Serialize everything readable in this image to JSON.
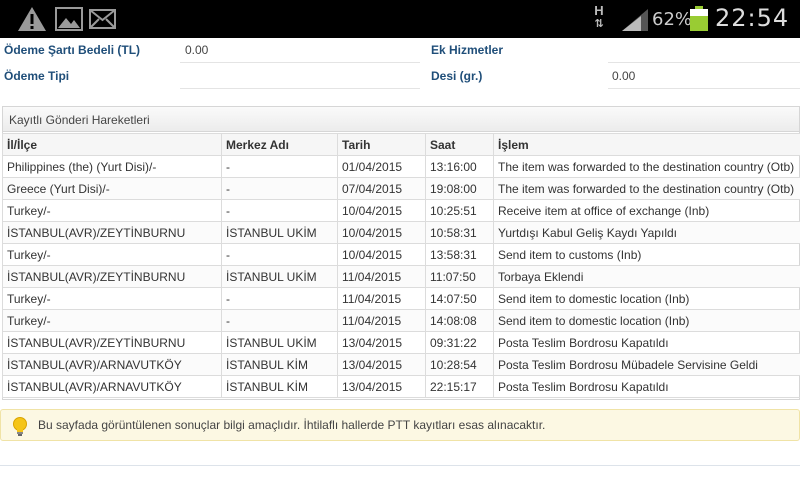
{
  "status_bar": {
    "battery_percent": "62%",
    "time": "22:54",
    "network_type": "H",
    "icons": [
      "warning-icon",
      "picture-icon",
      "mail-icon",
      "signal-icon",
      "battery-icon"
    ]
  },
  "info": {
    "row1": {
      "left_label": "Ödeme Şartı Bedeli (TL)",
      "left_value": "0.00",
      "right_label": "Ek Hizmetler",
      "right_value": ""
    },
    "row2": {
      "left_label": "Ödeme Tipi",
      "left_value": "",
      "right_label": "Desi (gr.)",
      "right_value": "0.00"
    }
  },
  "panel": {
    "title": "Kayıtlı Gönderi Hareketleri",
    "columns": [
      "İl/İlçe",
      "Merkez Adı",
      "Tarih",
      "Saat",
      "İşlem"
    ],
    "rows": [
      [
        "Philippines (the) (Yurt Disi)/-",
        "-",
        "01/04/2015",
        "13:16:00",
        "The item was forwarded to the destination country (Otb)"
      ],
      [
        "Greece (Yurt Disi)/-",
        "-",
        "07/04/2015",
        "19:08:00",
        "The item was forwarded to the destination country (Otb)"
      ],
      [
        "Turkey/-",
        "-",
        "10/04/2015",
        "10:25:51",
        "Receive item at office of exchange (Inb)"
      ],
      [
        "İSTANBUL(AVR)/ZEYTİNBURNU",
        "İSTANBUL UKİM",
        "10/04/2015",
        "10:58:31",
        "Yurtdışı Kabul Geliş Kaydı Yapıldı"
      ],
      [
        "Turkey/-",
        "-",
        "10/04/2015",
        "13:58:31",
        "Send item to customs (Inb)"
      ],
      [
        "İSTANBUL(AVR)/ZEYTİNBURNU",
        "İSTANBUL UKİM",
        "11/04/2015",
        "11:07:50",
        "Torbaya Eklendi"
      ],
      [
        "Turkey/-",
        "-",
        "11/04/2015",
        "14:07:50",
        "Send item to domestic location (Inb)"
      ],
      [
        "Turkey/-",
        "-",
        "11/04/2015",
        "14:08:08",
        "Send item to domestic location (Inb)"
      ],
      [
        "İSTANBUL(AVR)/ZEYTİNBURNU",
        "İSTANBUL UKİM",
        "13/04/2015",
        "09:31:22",
        "Posta Teslim Bordrosu Kapatıldı"
      ],
      [
        "İSTANBUL(AVR)/ARNAVUTKÖY",
        "İSTANBUL KİM",
        "13/04/2015",
        "10:28:54",
        "Posta Teslim Bordrosu Mübadele Servisine Geldi"
      ],
      [
        "İSTANBUL(AVR)/ARNAVUTKÖY",
        "İSTANBUL KİM",
        "13/04/2015",
        "22:15:17",
        "Posta Teslim Bordrosu Kapatıldı"
      ]
    ]
  },
  "notice": {
    "icon": "lightbulb-icon",
    "text": "Bu sayfada görüntülenen sonuçlar bilgi amaçlıdır. İhtilaflı hallerde PTT kayıtları esas alınacaktır."
  }
}
